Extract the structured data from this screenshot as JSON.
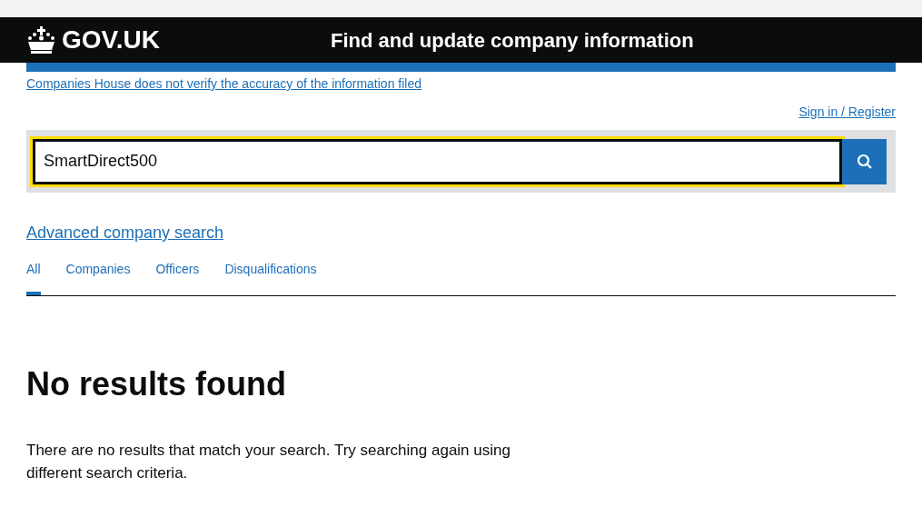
{
  "header": {
    "logo": "GOV.UK",
    "service_name": "Find and update company information"
  },
  "notice_link": "Companies House does not verify the accuracy of the information filed",
  "sign_in_link": "Sign in / Register",
  "search": {
    "value": "SmartDirect500",
    "focused": true
  },
  "advanced_search_link": "Advanced company search",
  "tabs": [
    {
      "label": "All",
      "selected": true
    },
    {
      "label": "Companies",
      "selected": false
    },
    {
      "label": "Officers",
      "selected": false
    },
    {
      "label": "Disqualifications",
      "selected": false
    }
  ],
  "heading": "No results found",
  "message": "There are no results that match your search. Try searching again using different search criteria."
}
